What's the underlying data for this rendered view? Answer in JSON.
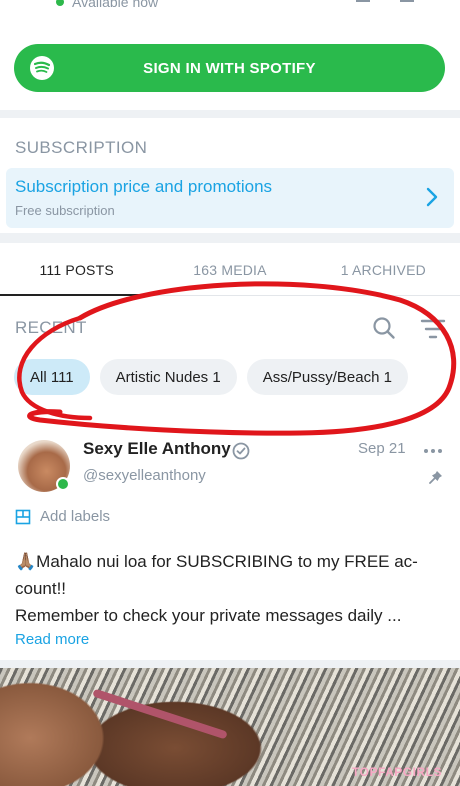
{
  "status": {
    "text": "Available now"
  },
  "spotify": {
    "label": "SIGN IN WITH SPOTIFY",
    "color": "#2aba4c"
  },
  "subscription": {
    "heading": "SUBSCRIPTION",
    "title": "Subscription price and promotions",
    "description": "Free subscription"
  },
  "tabs": [
    {
      "label": "111 POSTS",
      "active": true
    },
    {
      "label": "163 MEDIA",
      "active": false
    },
    {
      "label": "1 ARCHIVED",
      "active": false
    }
  ],
  "recent": {
    "label": "RECENT"
  },
  "chips": [
    {
      "label": "All 111",
      "active": true
    },
    {
      "label": "Artistic Nudes 1",
      "active": false
    },
    {
      "label": "Ass/Pussy/Beach 1",
      "active": false
    }
  ],
  "post": {
    "author_name": "Sexy Elle Anthony",
    "handle": "@sexyelleanthony",
    "date": "Sep 21",
    "add_labels": "Add labels",
    "text_line1": "🙏🏽Mahalo nui loa for SUBSCRIBING to my FREE ac-",
    "text_line2": "count!!",
    "text_line3": "Remember to check your private messages daily ...",
    "read_more": "Read more"
  },
  "watermark": "TOPFAPGIRLS",
  "colors": {
    "accent": "#1aa3e3",
    "muted": "#8a96a3",
    "online": "#2eb84b",
    "annotation": "#e0161b"
  }
}
